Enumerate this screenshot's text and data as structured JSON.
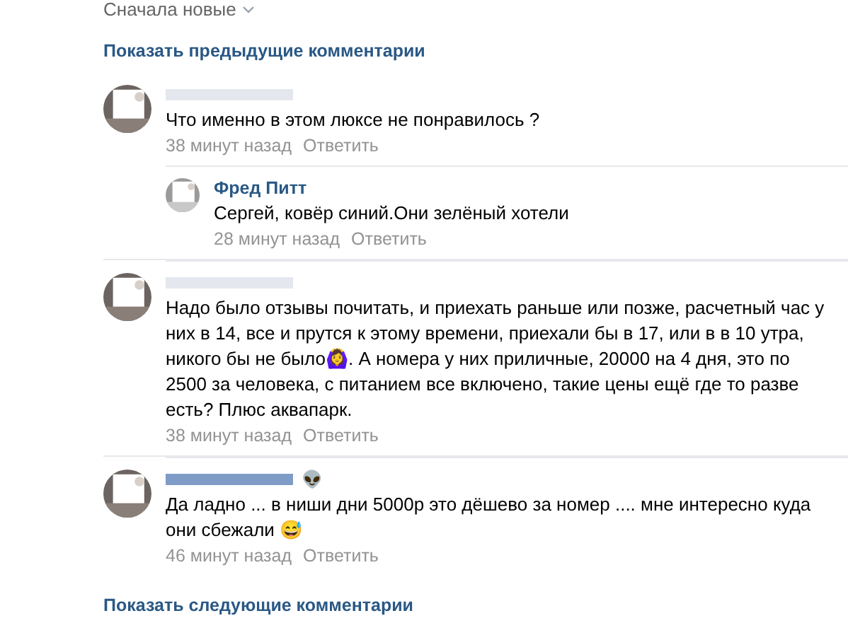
{
  "sort": {
    "label": "Сначала новые"
  },
  "show_previous": "Показать предыдущие комментарии",
  "comments": [
    {
      "color": "#e4e8ee",
      "text": "Что именно в этом люксе не понравилось ?",
      "time": "38 минут назад",
      "reply": "Ответить",
      "children": [
        {
          "author": "Фред Питт",
          "text": "Сергей, ковёр синий.Они зелёный хотели",
          "time": "28 минут назад",
          "reply": "Ответить"
        }
      ]
    },
    {
      "color": "#e4e8ee",
      "text": "Надо было отзывы почитать, и приехать раньше или позже, расчетный час у них в 14, все и прутся к этому времени, приехали бы в 17, или в в 10 утра, никого бы не было🙆‍♀️. А номера у них приличные, 20000 на 4 дня, это по 2500 за человека, с питанием все включено, такие цены ещё где то разве есть? Плюс аквапарк.",
      "time": "38 минут назад",
      "reply": "Ответить"
    },
    {
      "color": "#7f9cc7",
      "author_badge": "👽",
      "text": "Да ладно ... в ниши дни 5000р это дёшево за номер .... мне интересно куда они сбежали 😅",
      "time": "46 минут назад",
      "reply": "Ответить"
    }
  ],
  "show_next": "Показать следующие комментарии"
}
